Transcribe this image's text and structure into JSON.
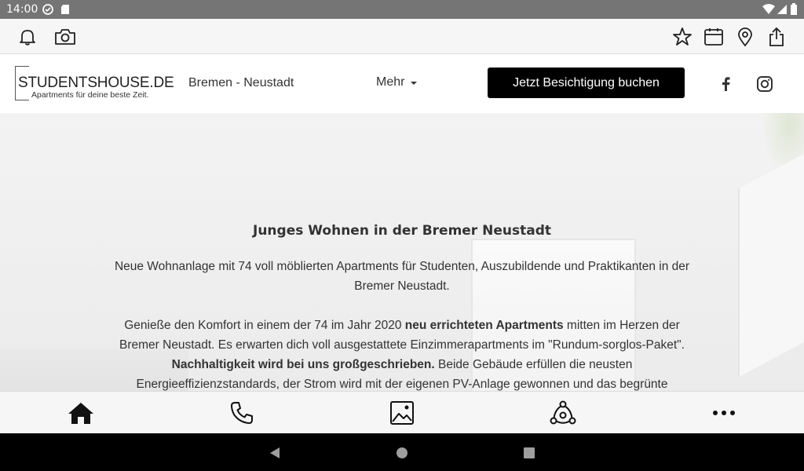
{
  "status_bar": {
    "time": "14:00"
  },
  "toolbar": {
    "icons": [
      "bell-icon",
      "camera-icon",
      "star-icon",
      "calendar-icon",
      "location-pin-icon",
      "share-icon"
    ]
  },
  "header": {
    "logo_brand": "STUDENTSHOUSE.DE",
    "logo_tagline": "Apartments für deine beste Zeit.",
    "location": "Bremen - Neustadt",
    "more_label": "Mehr",
    "cta_label": "Jetzt Besichtigung buchen"
  },
  "hero": {
    "title": "Junges Wohnen in der Bremer Neustadt",
    "p1": "Neue Wohnanlage mit 74 voll möblierten Apartments für Studenten, Auszubildende und Praktikanten in der Bremer Neustadt.",
    "p2_a": "Genieße den Komfort in einem der 74 im Jahr 2020 ",
    "p2_b": "neu errichteten Apartments",
    "p2_c": " mitten im Herzen der Bremer Neustadt. Es erwarten dich voll ausgestattete Einzimmerapartments im \"Rundum-sorglos-Paket\". ",
    "p2_d": "Nachhaltigkeit wird bei uns großgeschrieben.",
    "p2_e": " Beide Gebäude erfüllen die neusten Energieeffizienzstandards, der Strom wird mit der eigenen PV-Anlage gewonnen und das begrünte"
  },
  "bottom_nav": {
    "icons": [
      "home-icon",
      "phone-icon",
      "image-icon",
      "network-icon",
      "more-dots-icon"
    ]
  },
  "colors": {
    "cta_bg": "#000000",
    "toolbar_bg": "#f6f6f6",
    "status_bar_bg": "#757575"
  }
}
